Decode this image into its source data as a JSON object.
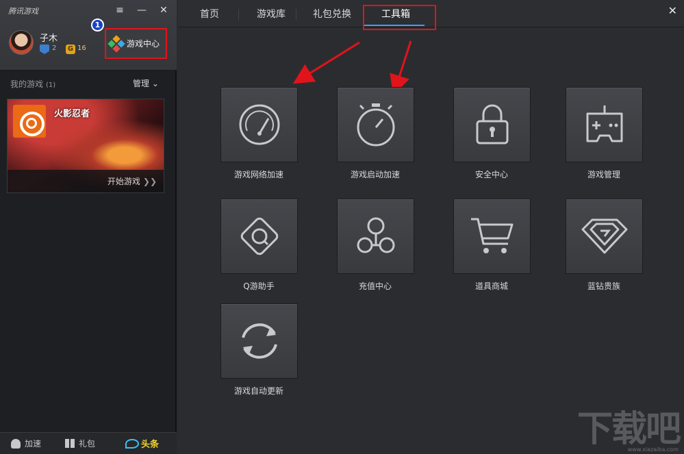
{
  "app": {
    "brand": "腾讯游戏"
  },
  "window_controls": {
    "menu": "≡",
    "minimize": "—",
    "close": "✕"
  },
  "user": {
    "name": "子木",
    "level_v": "2",
    "level_g": "16",
    "g_badge": "G"
  },
  "step_marker": "1",
  "game_center_button": "游戏中心",
  "my_games": {
    "label": "我的游戏",
    "count": "(1)",
    "manage": "管理 ⌄"
  },
  "game_card": {
    "title": "火影忍者",
    "play": "开始游戏",
    "play_chevron": "❯❯"
  },
  "bottom_bar": {
    "speed": "加速",
    "gift": "礼包",
    "news": "头条"
  },
  "tabs": {
    "home": "首页",
    "library": "游戏库",
    "gift_exchange": "礼包兑换",
    "toolbox": "工具箱"
  },
  "tiles": [
    {
      "label": "游戏网络加速",
      "icon": "speedometer-icon"
    },
    {
      "label": "游戏启动加速",
      "icon": "stopwatch-icon"
    },
    {
      "label": "安全中心",
      "icon": "lock-icon"
    },
    {
      "label": "游戏管理",
      "icon": "gamepad-icon"
    },
    {
      "label": "Q游助手",
      "icon": "q-assistant-icon"
    },
    {
      "label": "充值中心",
      "icon": "recharge-icon"
    },
    {
      "label": "道具商城",
      "icon": "cart-icon"
    },
    {
      "label": "蓝钻贵族",
      "icon": "diamond-icon"
    },
    {
      "label": "游戏自动更新",
      "icon": "refresh-icon"
    }
  ],
  "watermark": {
    "big": "下载吧",
    "small": "www.xiazaiba.com"
  },
  "colors": {
    "highlight": "#e0141a",
    "tab_underline": "#35a3ff",
    "news": "#f2d22a"
  }
}
